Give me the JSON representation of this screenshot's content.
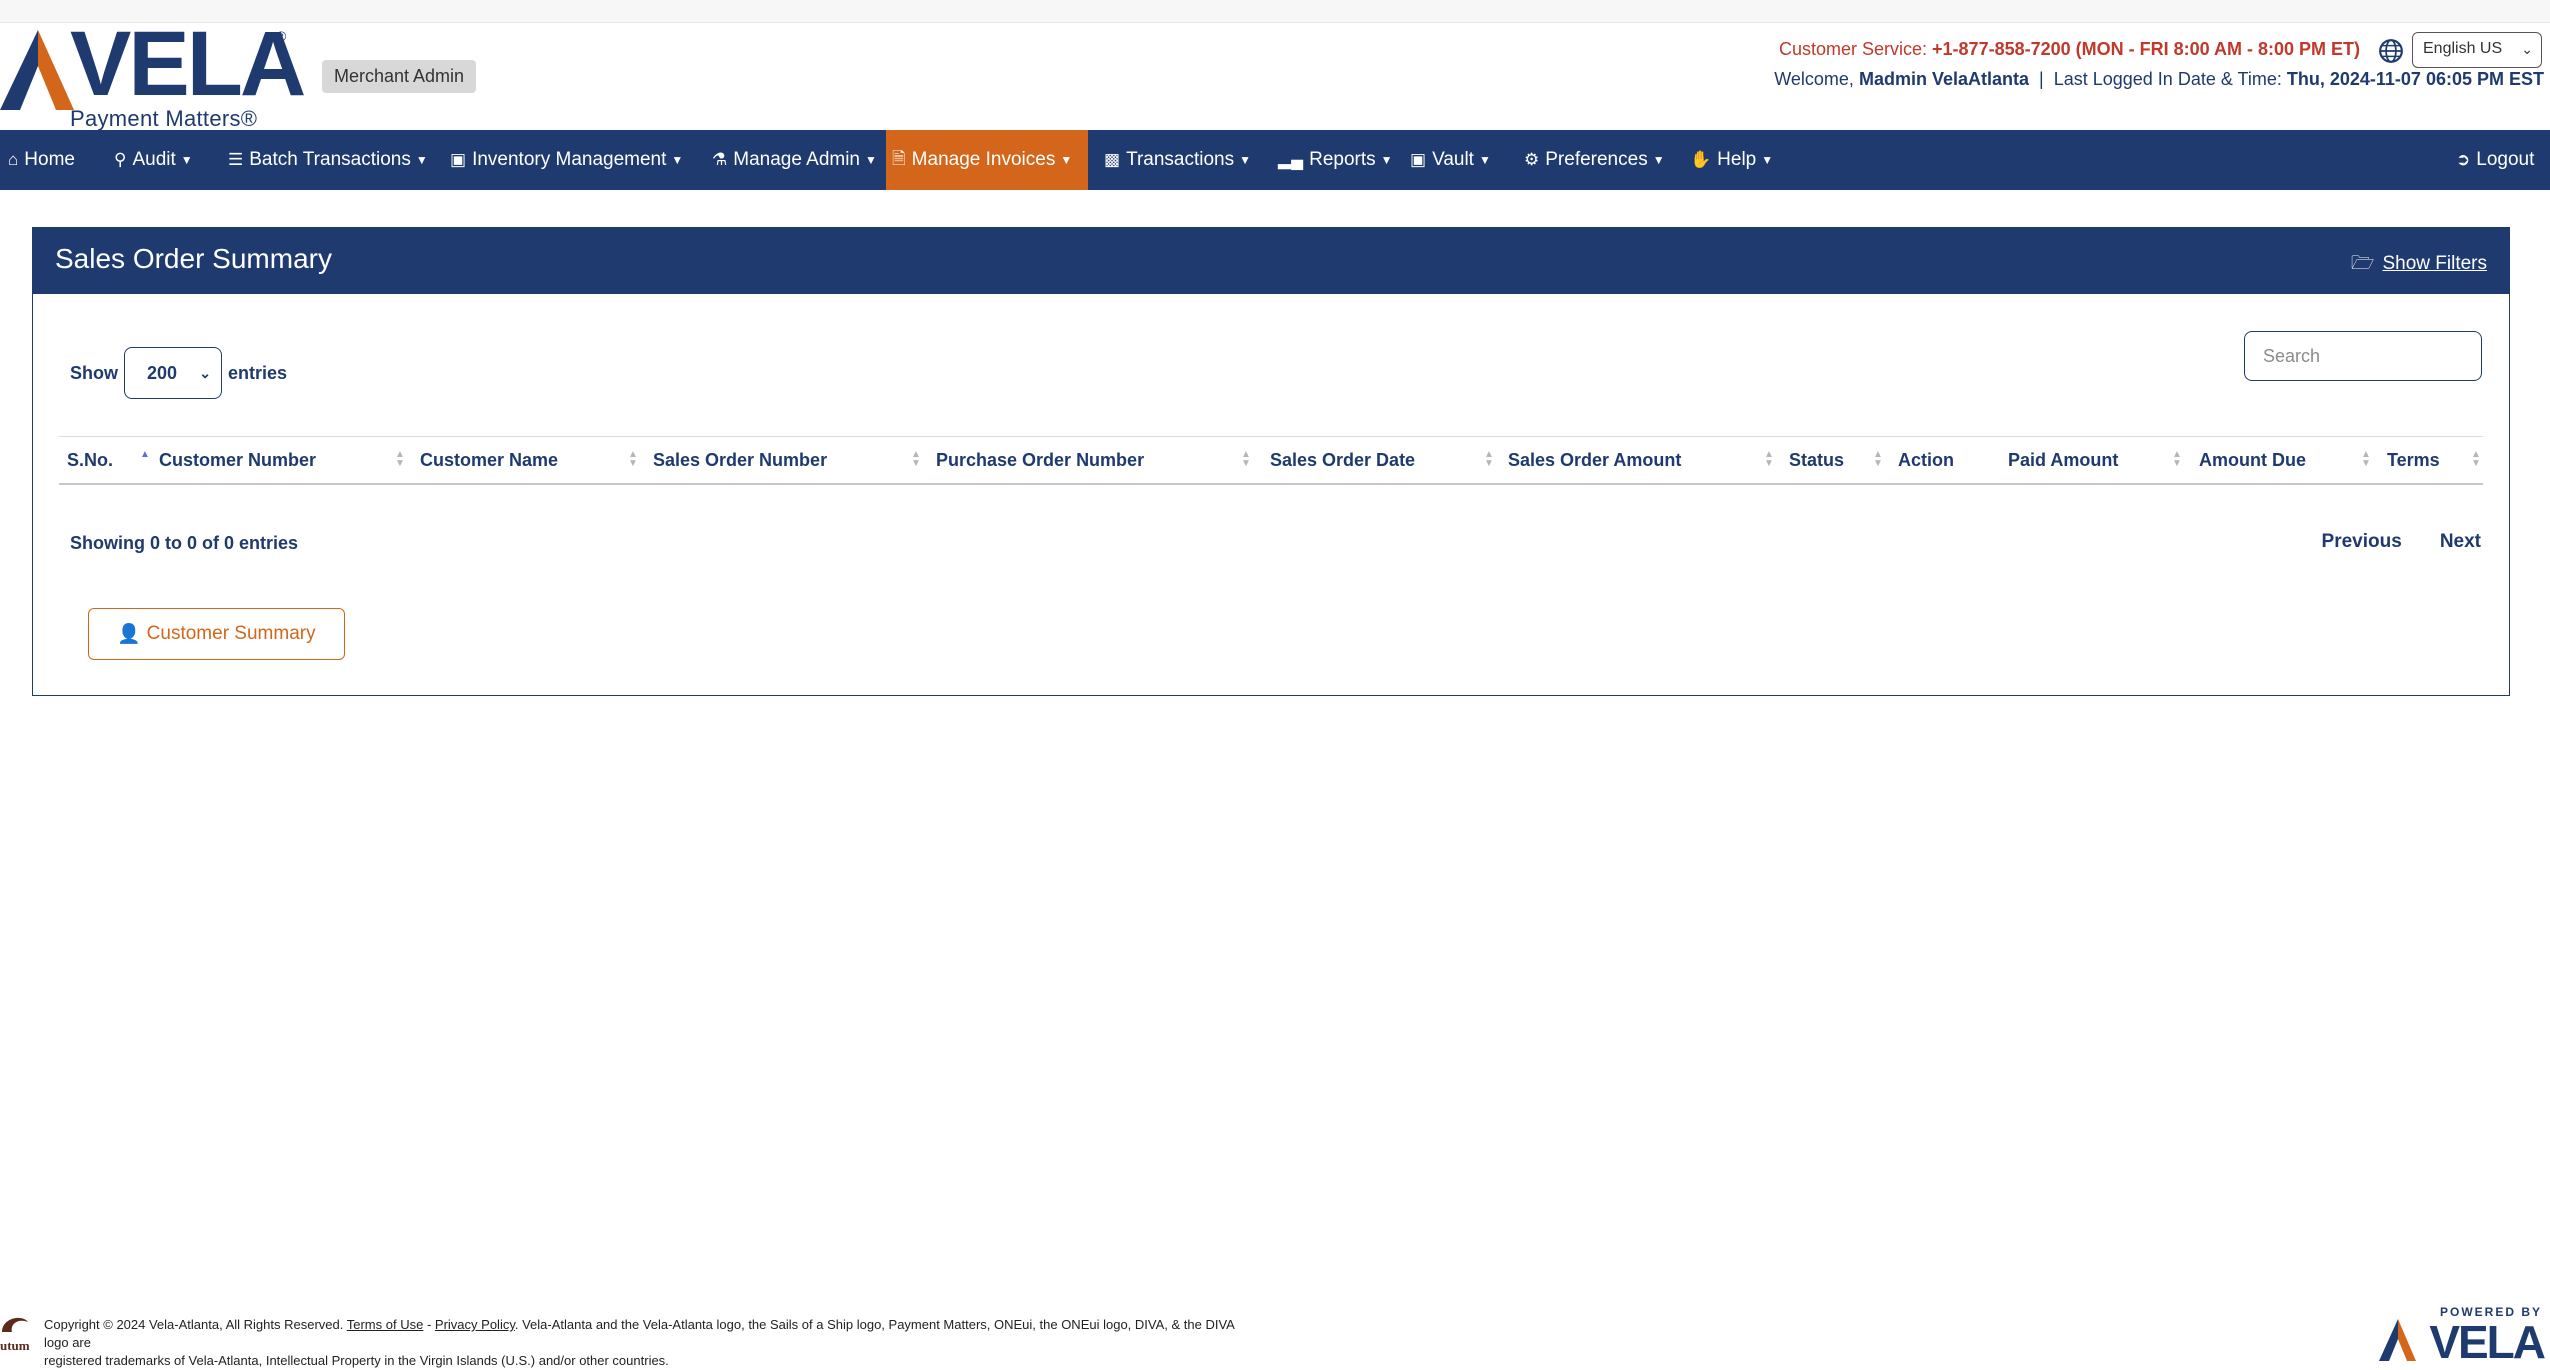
{
  "header": {
    "logo_text": "VELA",
    "logo_reg": "®",
    "logo_tagline": "Payment Matters®",
    "role_badge": "Merchant Admin",
    "customer_service_label": "Customer Service:",
    "customer_service_value": "+1-877-858-7200 (MON - FRI 8:00 AM - 8:00 PM ET)",
    "language": "English US",
    "welcome_label": "Welcome,",
    "user_name": "Madmin VelaAtlanta",
    "separator": "|",
    "last_login_label": "Last Logged In Date & Time:",
    "last_login_value": "Thu, 2024-11-07 06:05 PM EST"
  },
  "nav": {
    "items": [
      {
        "label": "Home",
        "icon": "home-icon"
      },
      {
        "label": "Audit",
        "icon": "search-icon"
      },
      {
        "label": "Batch Transactions",
        "icon": "layers-icon"
      },
      {
        "label": "Inventory Management",
        "icon": "warehouse-icon"
      },
      {
        "label": "Manage Admin",
        "icon": "users-icon"
      },
      {
        "label": "Manage Invoices",
        "icon": "file-icon"
      },
      {
        "label": "Transactions",
        "icon": "money-icon"
      },
      {
        "label": "Reports",
        "icon": "bar-chart-icon"
      },
      {
        "label": "Vault",
        "icon": "vault-icon"
      },
      {
        "label": "Preferences",
        "icon": "gear-icon"
      },
      {
        "label": "Help",
        "icon": "hand-icon"
      }
    ],
    "logout": "Logout",
    "active_color": "#d3661a",
    "bar_color": "#1f3a6e"
  },
  "panel": {
    "title": "Sales Order Summary",
    "show_filters": "Show Filters",
    "length_prefix": "Show",
    "length_value": "200",
    "length_suffix": "entries",
    "search_placeholder": "Search",
    "columns": [
      "S.No.",
      "Customer Number",
      "Customer Name",
      "Sales Order Number",
      "Purchase Order Number",
      "Sales Order Date",
      "Sales Order Amount",
      "Status",
      "Action",
      "Paid Amount",
      "Amount Due",
      "Terms"
    ],
    "info": "Showing 0 to 0 of 0 entries",
    "previous": "Previous",
    "next": "Next",
    "customer_summary_button": "Customer Summary"
  },
  "footer": {
    "copyright": "Copyright © 2024 Vela-Atlanta, All Rights Reserved.",
    "terms": "Terms of Use",
    "dash": "-",
    "privacy": "Privacy Policy",
    "trademark_1": ". Vela-Atlanta and the Vela-Atlanta logo, the Sails of a Ship logo, Payment Matters, ONEui, the ONEui logo, DIVA, & the DIVA logo are",
    "trademark_2": "registered trademarks of Vela-Atlanta, Intellectual Property in the Virgin Islands (U.S.) and/or other countries.",
    "left_logo_text": "utum",
    "powered_by": "POWERED BY",
    "powered_logo": "VELA"
  }
}
